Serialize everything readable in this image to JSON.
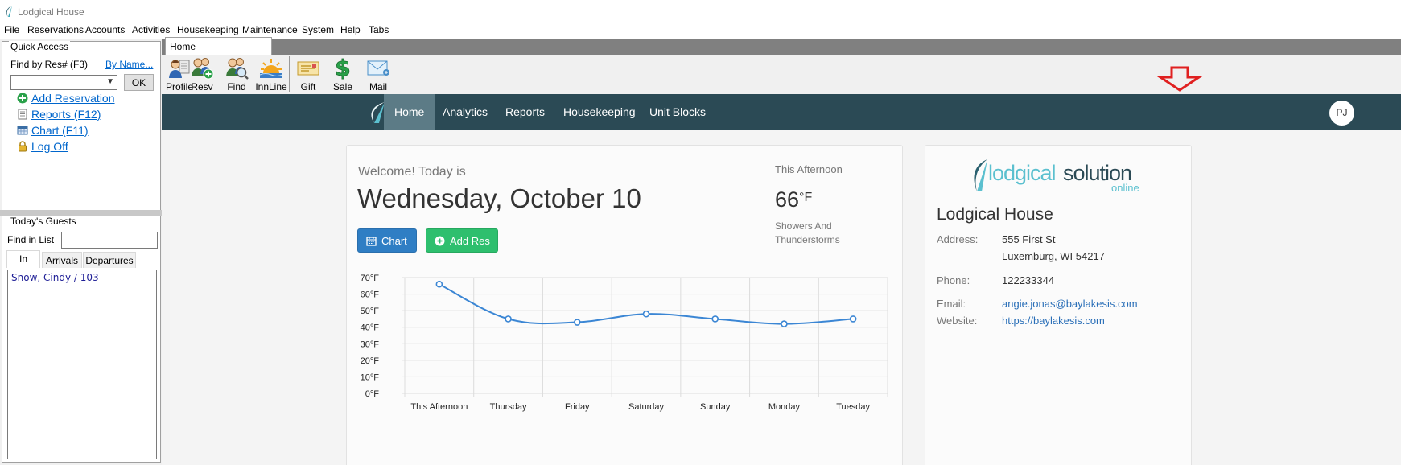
{
  "window": {
    "title": "Lodgical House"
  },
  "menu": [
    "File",
    "Reservations",
    "Accounts",
    "Activities",
    "Housekeeping",
    "Maintenance",
    "System",
    "Help",
    "Tabs"
  ],
  "quick_access": {
    "title": "Quick Access",
    "find_label": "Find by Res# (F3)",
    "by_name": "By Name...",
    "ok": "OK",
    "links": [
      "Add Reservation",
      "Reports (F12)",
      "Chart (F11)",
      "Log Off"
    ]
  },
  "todays_guests": {
    "title": "Today's Guests",
    "find_label": "Find in List",
    "tabs": [
      "In",
      "Arrivals",
      "Departures"
    ],
    "guests": [
      "Snow, Cindy / 103"
    ]
  },
  "doc_tab": "Home",
  "toolbar": [
    "Profile",
    "Resv",
    "Find",
    "InnLine",
    "Gift",
    "Sale",
    "Mail"
  ],
  "nav": {
    "items": [
      "Home",
      "Analytics",
      "Reports",
      "Housekeeping",
      "Unit Blocks"
    ],
    "active": "Home",
    "avatar": "PJ"
  },
  "welcome": {
    "greeting": "Welcome! Today is",
    "date": "Wednesday, October 10",
    "chart_button": "Chart",
    "add_res_button": "Add Res"
  },
  "weather": {
    "label": "This Afternoon",
    "temp": "66",
    "unit": "°F",
    "desc": "Showers And Thunderstorms"
  },
  "chart_data": {
    "type": "line",
    "categories": [
      "This Afternoon",
      "Thursday",
      "Friday",
      "Saturday",
      "Sunday",
      "Monday",
      "Tuesday"
    ],
    "series": [
      {
        "values": [
          66,
          45,
          43,
          48,
          45,
          42,
          45
        ]
      }
    ],
    "ylim": [
      0,
      70
    ],
    "yticks": [
      0,
      10,
      20,
      30,
      40,
      50,
      60,
      70
    ],
    "ytick_suffix": "°F",
    "grid": true,
    "color": "#3b86d4"
  },
  "property": {
    "logo_text_a": "lodgical",
    "logo_text_b": "solution",
    "logo_sub": "online",
    "name": "Lodgical House",
    "address_label": "Address:",
    "address_line1": "555 First St",
    "address_line2": "Luxemburg, WI 54217",
    "phone_label": "Phone:",
    "phone": "122233344",
    "email_label": "Email:",
    "email": "angie.jonas@baylakesis.com",
    "website_label": "Website:",
    "website": "https://baylakesis.com"
  },
  "colors": {
    "navbar": "#2b4a55",
    "nav_active": "#5c7b86",
    "chart_button": "#2f7ec4",
    "add_res_button": "#2ebf6e",
    "link": "#0066cc"
  }
}
